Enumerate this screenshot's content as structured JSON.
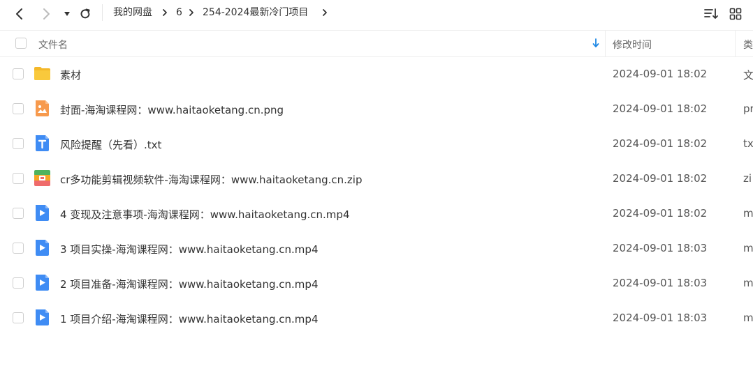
{
  "breadcrumb": [
    "我的网盘",
    "6",
    "254-2024最新冷门项目"
  ],
  "columns": {
    "name": "文件名",
    "modified": "修改时间",
    "type": "类"
  },
  "files": [
    {
      "icon": "folder-icon",
      "name": "素材",
      "modified": "2024-09-01 18:02",
      "type": "文"
    },
    {
      "icon": "image-file-icon",
      "name": "封面-海淘课程网：www.haitaoketang.cn.png",
      "modified": "2024-09-01 18:02",
      "type": "pr"
    },
    {
      "icon": "text-file-icon",
      "name": "风险提醒（先看）.txt",
      "modified": "2024-09-01 18:02",
      "type": "tx"
    },
    {
      "icon": "zip-file-icon",
      "name": "cr多功能剪辑视频软件-海淘课程网：www.haitaoketang.cn.zip",
      "modified": "2024-09-01 18:02",
      "type": "zi"
    },
    {
      "icon": "video-file-icon",
      "name": "4 变现及注意事项-海淘课程网：www.haitaoketang.cn.mp4",
      "modified": "2024-09-01 18:02",
      "type": "m"
    },
    {
      "icon": "video-file-icon",
      "name": "3 项目实操-海淘课程网：www.haitaoketang.cn.mp4",
      "modified": "2024-09-01 18:03",
      "type": "m"
    },
    {
      "icon": "video-file-icon",
      "name": "2 项目准备-海淘课程网：www.haitaoketang.cn.mp4",
      "modified": "2024-09-01 18:03",
      "type": "m"
    },
    {
      "icon": "video-file-icon",
      "name": "1 项目介绍-海淘课程网：www.haitaoketang.cn.mp4",
      "modified": "2024-09-01 18:03",
      "type": "m"
    }
  ],
  "colors": {
    "accent": "#1e88e5",
    "folder": "#f9c93c",
    "image": "#f79a4d",
    "text": "#3f8cf4",
    "video": "#3f8cf4"
  }
}
